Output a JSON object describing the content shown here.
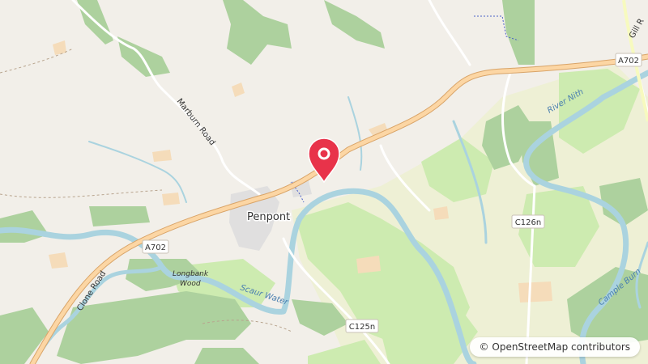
{
  "map": {
    "place_label": "Penpont",
    "roads": {
      "marburn": "Marburn Road",
      "clone": "Clone Road",
      "gill": "Gill R"
    },
    "shields": {
      "a702_west": "A702",
      "a702_east": "A702",
      "c126n": "C126n",
      "c125n": "C125n"
    },
    "water": {
      "nith": "River Nith",
      "scaur": "Scaur Water",
      "cample": "Cample Burn"
    },
    "woods": {
      "longbank_line1": "Longbank",
      "longbank_line2": "Wood"
    },
    "marker_color": "#e8334a",
    "attribution_symbol": "©",
    "attribution_text": "OpenStreetMap contributors"
  }
}
